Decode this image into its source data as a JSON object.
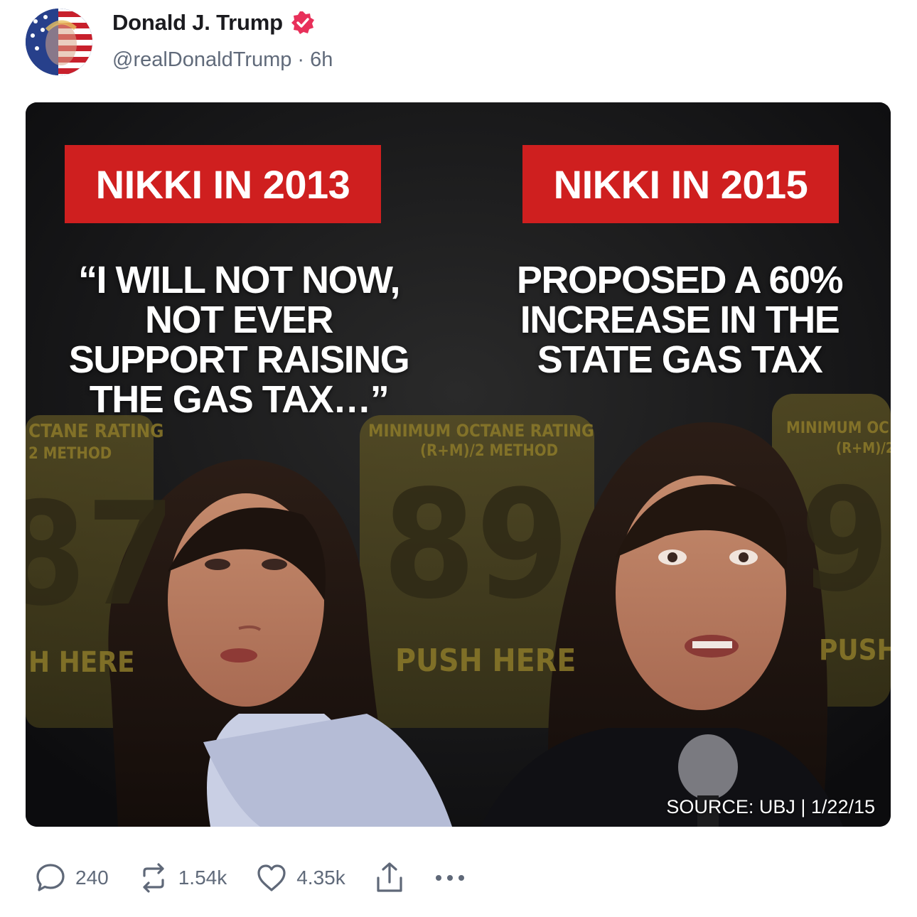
{
  "post": {
    "author": {
      "display_name": "Donald J. Trump",
      "handle": "@realDonaldTrump",
      "separator": "·",
      "time_ago": "6h",
      "verified_icon": "verified-badge-icon",
      "verified_color": "#e8305a"
    },
    "media": {
      "left_banner": "NIKKI IN 2013",
      "right_banner": "NIKKI IN 2015",
      "left_quote_lines": [
        "“I WILL NOT NOW,",
        "NOT EVER",
        "SUPPORT RAISING",
        "THE GAS TAX…”"
      ],
      "right_quote_lines": [
        "PROPOSED A 60%",
        "INCREASE IN THE",
        "STATE GAS TAX"
      ],
      "pump_labels": {
        "octane_left": "CTANE RATING",
        "method_left": "2 METHOD",
        "octane_mid": "MINIMUM OCTANE RATING",
        "method_mid": "(R+M)/2 METHOD",
        "octane_right": "MINIMUM OC",
        "method_right": "(R+M)/2",
        "number_left": "87",
        "number_mid": "89",
        "number_right": "9",
        "push_left": "H HERE",
        "push_mid": "PUSH HERE",
        "push_right": "PUSH"
      },
      "source": "SOURCE: UBJ | 1/22/15",
      "banner_color": "#cf1f1f"
    },
    "actions": {
      "replies": "240",
      "reposts": "1.54k",
      "likes": "4.35k",
      "reply_icon": "reply-icon",
      "repost_icon": "repost-icon",
      "like_icon": "heart-icon",
      "share_icon": "share-icon",
      "more_icon": "more-icon"
    }
  }
}
